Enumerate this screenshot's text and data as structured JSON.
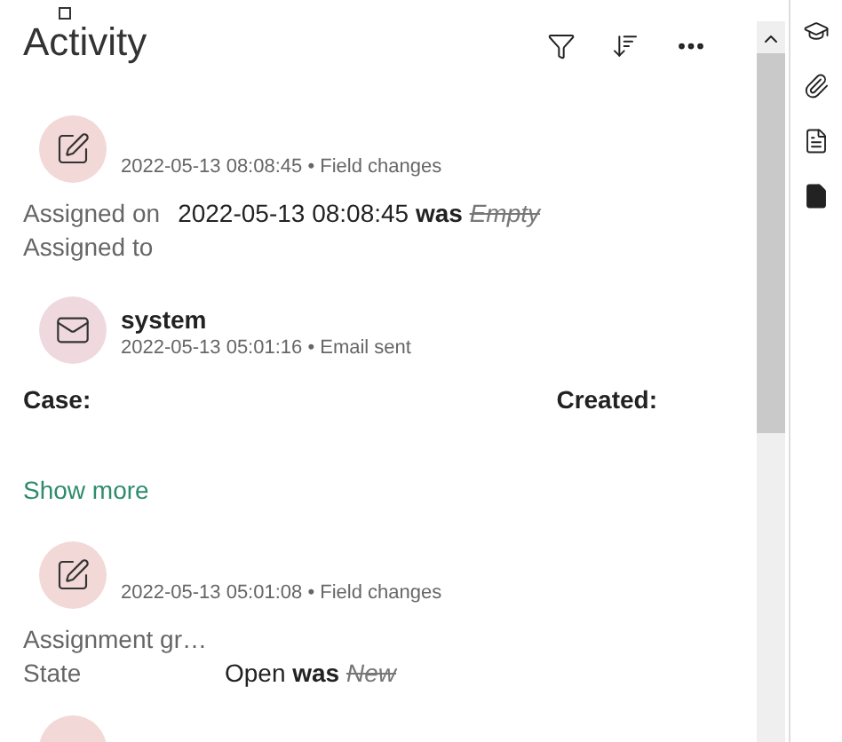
{
  "title": "Activity",
  "entries": [
    {
      "kind": "field_changes",
      "meta": "2022-05-13 08:08:45 • Field changes",
      "changes": [
        {
          "field": "Assigned on",
          "value": "2022-05-13 08:08:45",
          "was_label": "was",
          "old": "Empty"
        },
        {
          "field": "Assigned to"
        }
      ]
    },
    {
      "kind": "email",
      "author": "system",
      "meta": "2022-05-13 05:01:16 • Email sent",
      "labels": [
        "Case:",
        "Created:"
      ],
      "link": "Show more"
    },
    {
      "kind": "field_changes",
      "meta": "2022-05-13 05:01:08 • Field changes",
      "changes": [
        {
          "field": "Assignment gr…"
        },
        {
          "field": "State",
          "value": "Open",
          "was_label": "was",
          "old": "New"
        }
      ]
    }
  ]
}
